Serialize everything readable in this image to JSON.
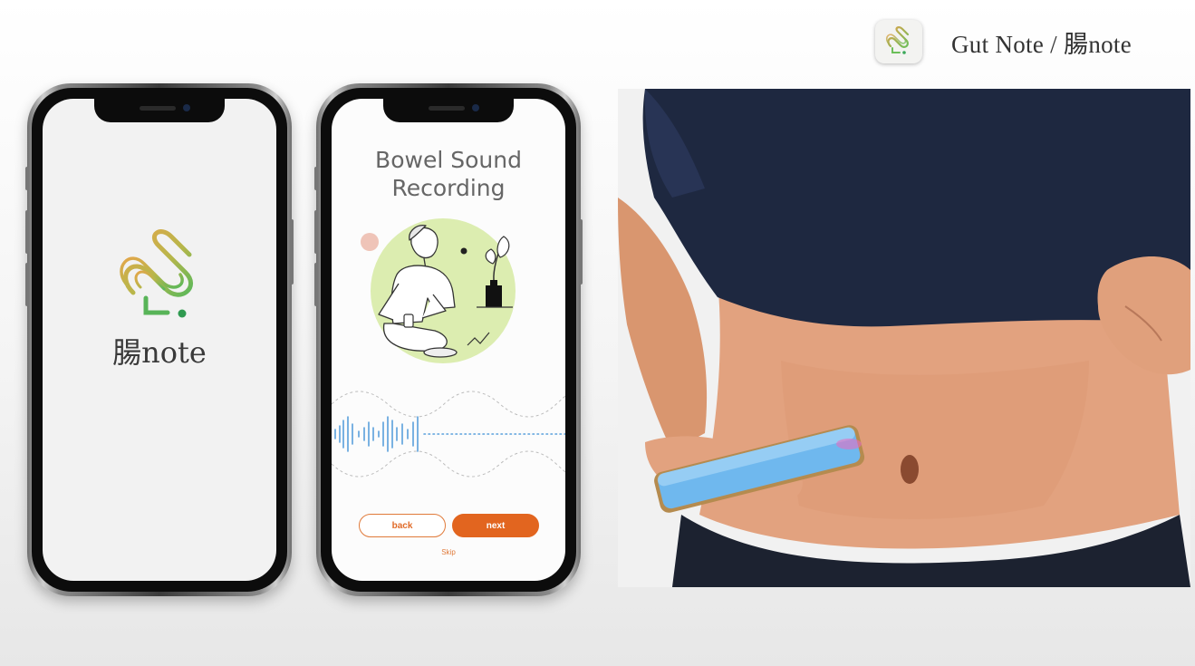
{
  "brand": {
    "title": "Gut Note / 腸note",
    "icon": "gut-spiral-logo-icon"
  },
  "splash": {
    "app_name": "腸note",
    "logo_icon": "gut-spiral-logo-icon"
  },
  "recording": {
    "title_line1": "Bowel Sound",
    "title_line2": "Recording",
    "back_label": "back",
    "next_label": "next",
    "skip_label": "Skip",
    "illustration_icon": "person-recording-abdomen-illustration",
    "waveform_icon": "audio-waveform-icon"
  },
  "photo": {
    "description_icon": "phone-on-abdomen-photo"
  },
  "colors": {
    "accent_orange": "#e2651f",
    "illustration_green": "#dcedb0",
    "waveform_blue": "#5aa0dc",
    "shirt_navy": "#1e2840",
    "skin": "#e3a581"
  }
}
